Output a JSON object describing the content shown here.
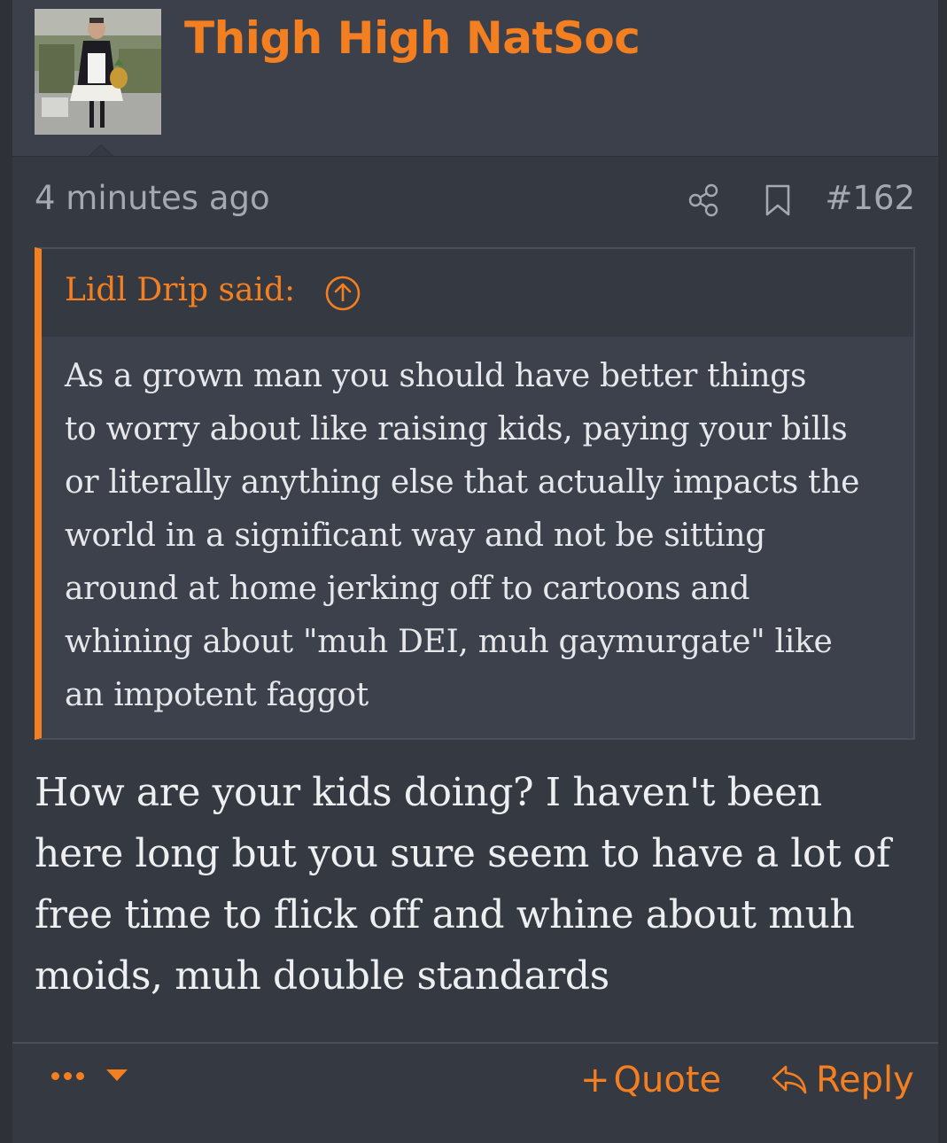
{
  "post": {
    "username": "Thigh High NatSoc",
    "timestamp": "4 minutes ago",
    "post_number": "#162",
    "quote": {
      "author_label": "Lidl Drip said:",
      "lines": [
        "As a grown man you should have better things",
        "to worry about like raising kids, paying your bills",
        "or literally anything else that actually impacts the",
        "world in a significant way and not be sitting",
        "around at home jerking off to cartoons and",
        "whining about \"muh DEI, muh gaymurgate\" like",
        "an impotent faggot"
      ]
    },
    "message_lines": [
      "How are your kids doing? I haven't been",
      "here long but you sure seem to have a lot of",
      "free time to flick off and whine about muh",
      "moids, muh double standards"
    ]
  },
  "actions": {
    "quote_plus": "+",
    "quote_label": "Quote",
    "reply_label": "Reply"
  },
  "icons": {
    "share": "share-icon",
    "bookmark": "bookmark-icon",
    "quote_jump": "arrow-up-circle-icon",
    "reply": "reply-icon",
    "more": "ellipsis-caret-icon"
  },
  "colors": {
    "accent": "#f47f20",
    "background": "#353942",
    "header_background": "#3c404a",
    "quote_background": "#3d414b",
    "muted_text": "#a4a8b1",
    "body_text": "#eeeff1"
  }
}
